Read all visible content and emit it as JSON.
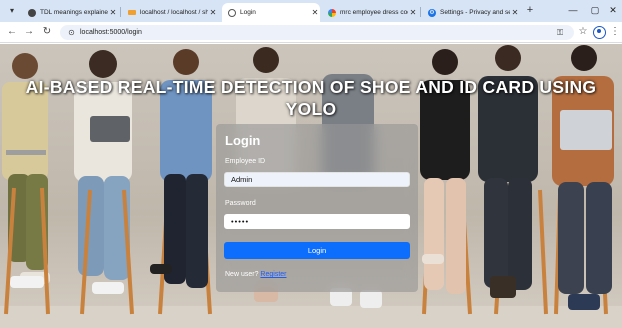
{
  "browser": {
    "tabs": [
      {
        "title": "TDL meanings explained",
        "favicon": "chat-favicon-icon",
        "active": false
      },
      {
        "title": "localhost / localhost / sh",
        "favicon": "phpmyadmin-favicon-icon",
        "active": false
      },
      {
        "title": "Login",
        "favicon": "globe-favicon-icon",
        "active": true
      },
      {
        "title": "mrc employee dress cod",
        "favicon": "google-favicon-icon",
        "active": false
      },
      {
        "title": "Settings - Privacy and se",
        "favicon": "settings-favicon-icon",
        "active": false
      }
    ],
    "url": "localhost:5000/login"
  },
  "page": {
    "headline": "AI-BASED REAL-TIME DETECTION OF SHOE AND ID CARD USING YOLO",
    "login": {
      "title": "Login",
      "employee_id_label": "Employee ID",
      "employee_id_value": "Admin",
      "password_label": "Password",
      "password_value": "•••••",
      "button_label": "Login",
      "new_user_text": "New user?",
      "register_label": "Register"
    }
  },
  "colors": {
    "accent": "#0d6efd",
    "tabbar": "#d6e4f5",
    "link": "#1a5dff"
  }
}
